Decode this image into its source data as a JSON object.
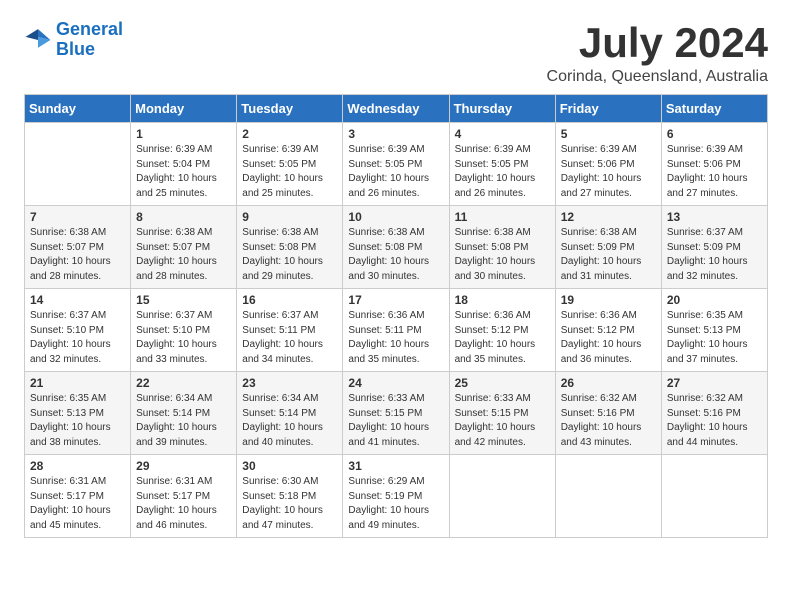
{
  "header": {
    "logo_line1": "General",
    "logo_line2": "Blue",
    "month_year": "July 2024",
    "location": "Corinda, Queensland, Australia"
  },
  "days_of_week": [
    "Sunday",
    "Monday",
    "Tuesday",
    "Wednesday",
    "Thursday",
    "Friday",
    "Saturday"
  ],
  "weeks": [
    [
      {
        "day": "",
        "info": ""
      },
      {
        "day": "1",
        "info": "Sunrise: 6:39 AM\nSunset: 5:04 PM\nDaylight: 10 hours\nand 25 minutes."
      },
      {
        "day": "2",
        "info": "Sunrise: 6:39 AM\nSunset: 5:05 PM\nDaylight: 10 hours\nand 25 minutes."
      },
      {
        "day": "3",
        "info": "Sunrise: 6:39 AM\nSunset: 5:05 PM\nDaylight: 10 hours\nand 26 minutes."
      },
      {
        "day": "4",
        "info": "Sunrise: 6:39 AM\nSunset: 5:05 PM\nDaylight: 10 hours\nand 26 minutes."
      },
      {
        "day": "5",
        "info": "Sunrise: 6:39 AM\nSunset: 5:06 PM\nDaylight: 10 hours\nand 27 minutes."
      },
      {
        "day": "6",
        "info": "Sunrise: 6:39 AM\nSunset: 5:06 PM\nDaylight: 10 hours\nand 27 minutes."
      }
    ],
    [
      {
        "day": "7",
        "info": "Sunrise: 6:38 AM\nSunset: 5:07 PM\nDaylight: 10 hours\nand 28 minutes."
      },
      {
        "day": "8",
        "info": "Sunrise: 6:38 AM\nSunset: 5:07 PM\nDaylight: 10 hours\nand 28 minutes."
      },
      {
        "day": "9",
        "info": "Sunrise: 6:38 AM\nSunset: 5:08 PM\nDaylight: 10 hours\nand 29 minutes."
      },
      {
        "day": "10",
        "info": "Sunrise: 6:38 AM\nSunset: 5:08 PM\nDaylight: 10 hours\nand 30 minutes."
      },
      {
        "day": "11",
        "info": "Sunrise: 6:38 AM\nSunset: 5:08 PM\nDaylight: 10 hours\nand 30 minutes."
      },
      {
        "day": "12",
        "info": "Sunrise: 6:38 AM\nSunset: 5:09 PM\nDaylight: 10 hours\nand 31 minutes."
      },
      {
        "day": "13",
        "info": "Sunrise: 6:37 AM\nSunset: 5:09 PM\nDaylight: 10 hours\nand 32 minutes."
      }
    ],
    [
      {
        "day": "14",
        "info": "Sunrise: 6:37 AM\nSunset: 5:10 PM\nDaylight: 10 hours\nand 32 minutes."
      },
      {
        "day": "15",
        "info": "Sunrise: 6:37 AM\nSunset: 5:10 PM\nDaylight: 10 hours\nand 33 minutes."
      },
      {
        "day": "16",
        "info": "Sunrise: 6:37 AM\nSunset: 5:11 PM\nDaylight: 10 hours\nand 34 minutes."
      },
      {
        "day": "17",
        "info": "Sunrise: 6:36 AM\nSunset: 5:11 PM\nDaylight: 10 hours\nand 35 minutes."
      },
      {
        "day": "18",
        "info": "Sunrise: 6:36 AM\nSunset: 5:12 PM\nDaylight: 10 hours\nand 35 minutes."
      },
      {
        "day": "19",
        "info": "Sunrise: 6:36 AM\nSunset: 5:12 PM\nDaylight: 10 hours\nand 36 minutes."
      },
      {
        "day": "20",
        "info": "Sunrise: 6:35 AM\nSunset: 5:13 PM\nDaylight: 10 hours\nand 37 minutes."
      }
    ],
    [
      {
        "day": "21",
        "info": "Sunrise: 6:35 AM\nSunset: 5:13 PM\nDaylight: 10 hours\nand 38 minutes."
      },
      {
        "day": "22",
        "info": "Sunrise: 6:34 AM\nSunset: 5:14 PM\nDaylight: 10 hours\nand 39 minutes."
      },
      {
        "day": "23",
        "info": "Sunrise: 6:34 AM\nSunset: 5:14 PM\nDaylight: 10 hours\nand 40 minutes."
      },
      {
        "day": "24",
        "info": "Sunrise: 6:33 AM\nSunset: 5:15 PM\nDaylight: 10 hours\nand 41 minutes."
      },
      {
        "day": "25",
        "info": "Sunrise: 6:33 AM\nSunset: 5:15 PM\nDaylight: 10 hours\nand 42 minutes."
      },
      {
        "day": "26",
        "info": "Sunrise: 6:32 AM\nSunset: 5:16 PM\nDaylight: 10 hours\nand 43 minutes."
      },
      {
        "day": "27",
        "info": "Sunrise: 6:32 AM\nSunset: 5:16 PM\nDaylight: 10 hours\nand 44 minutes."
      }
    ],
    [
      {
        "day": "28",
        "info": "Sunrise: 6:31 AM\nSunset: 5:17 PM\nDaylight: 10 hours\nand 45 minutes."
      },
      {
        "day": "29",
        "info": "Sunrise: 6:31 AM\nSunset: 5:17 PM\nDaylight: 10 hours\nand 46 minutes."
      },
      {
        "day": "30",
        "info": "Sunrise: 6:30 AM\nSunset: 5:18 PM\nDaylight: 10 hours\nand 47 minutes."
      },
      {
        "day": "31",
        "info": "Sunrise: 6:29 AM\nSunset: 5:19 PM\nDaylight: 10 hours\nand 49 minutes."
      },
      {
        "day": "",
        "info": ""
      },
      {
        "day": "",
        "info": ""
      },
      {
        "day": "",
        "info": ""
      }
    ]
  ]
}
